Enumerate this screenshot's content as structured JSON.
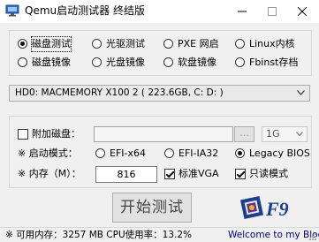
{
  "window": {
    "title": "Qemu启动测试器 终结版",
    "icon": "monitor-app-icon"
  },
  "boot_source": {
    "options": [
      {
        "label": "磁盘测试",
        "selected": true
      },
      {
        "label": "光驱测试",
        "selected": false
      },
      {
        "label": "PXE 网启",
        "selected": false
      },
      {
        "label": "Linux内核",
        "selected": false
      },
      {
        "label": "磁盘镜像",
        "selected": false
      },
      {
        "label": "光盘镜像",
        "selected": false
      },
      {
        "label": "软盘镜像",
        "selected": false
      },
      {
        "label": "Fbinst存档",
        "selected": false
      }
    ]
  },
  "disk_select": {
    "value": "HD0:  MACMEMORY X100 2 ( 223.6GB, C: D: )"
  },
  "extra_disk": {
    "label": "附加磁盘：",
    "checked": false,
    "path": "",
    "browse_label": "...",
    "size_value": "1G"
  },
  "boot_mode": {
    "label": "※ 启动模式：",
    "options": [
      {
        "label": "EFI-x64",
        "selected": false
      },
      {
        "label": "EFI-IA32",
        "selected": false
      },
      {
        "label": "Legacy BIOS",
        "selected": true
      }
    ]
  },
  "memory": {
    "label": "※ 内存（M）：",
    "value": "816",
    "std_vga_label": "标准VGA",
    "std_vga_checked": true,
    "readonly_label": "只读模式",
    "readonly_checked": true
  },
  "start_button": {
    "label": "开始测试"
  },
  "logo": {
    "text": "F9",
    "icon": "f9-logo-icon"
  },
  "status": {
    "memory_text": "※ 可用内存：3257 MB  CPU使用率：13.2%",
    "link_text": "Welcome to my Blog"
  }
}
